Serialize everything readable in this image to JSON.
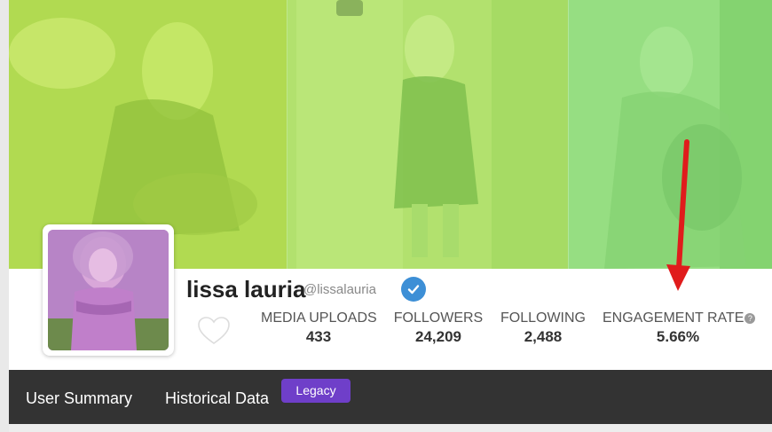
{
  "profile": {
    "name": "lissa lauria",
    "handle": "@lissalauria",
    "verified": true
  },
  "stats": [
    {
      "label": "MEDIA UPLOADS",
      "value": "433"
    },
    {
      "label": "FOLLOWERS",
      "value": "24,209"
    },
    {
      "label": "FOLLOWING",
      "value": "2,488"
    },
    {
      "label": "ENGAGEMENT RATE",
      "value": "5.66%"
    }
  ],
  "nav": {
    "items": [
      {
        "label": "User Summary"
      },
      {
        "label": "Historical Data"
      }
    ],
    "badge": "Legacy"
  },
  "icons": {
    "verified": "verified-check-icon",
    "favorite": "heart-icon",
    "help": "question-mark-icon",
    "help_glyph": "?"
  },
  "colors": {
    "banner_overlay": "#a9e06a",
    "verified": "#3d8fd6",
    "badge": "#6f3fc9",
    "navbar": "#333333",
    "arrow": "#e01c1c"
  }
}
